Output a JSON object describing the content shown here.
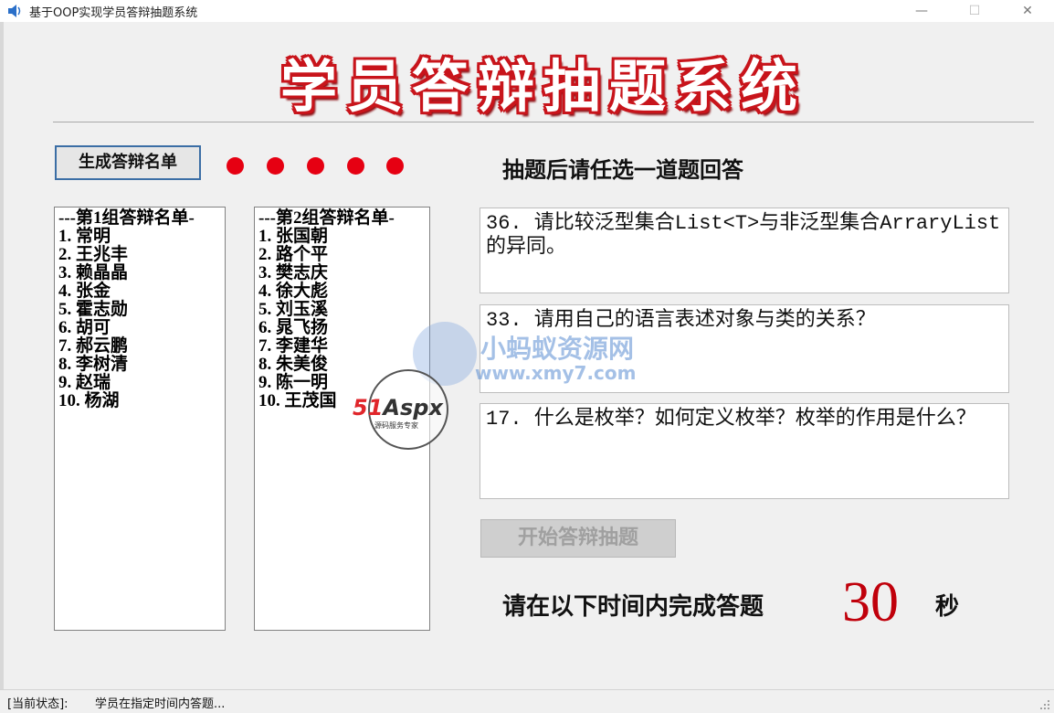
{
  "window": {
    "title": "基于OOP实现学员答辩抽题系统",
    "controls": [
      "—",
      "☐",
      "✕"
    ]
  },
  "banner": {
    "title": "学员答辩抽题系统"
  },
  "generate_button": {
    "label": "生成答辩名单"
  },
  "indicator_dots": {
    "count": 5,
    "color": "#e60012"
  },
  "hint": {
    "text": "抽题后请任选一道题回答"
  },
  "group1": {
    "items": [
      "---第1组答辩名单-",
      "1. 常明",
      "2. 王兆丰",
      "3. 赖晶晶",
      "4. 张金",
      "5. 霍志勋",
      "6. 胡可",
      "7. 郝云鹏",
      "8. 李树清",
      "9. 赵瑞",
      "10. 杨湖"
    ]
  },
  "group2": {
    "items": [
      "---第2组答辩名单-",
      "1. 张国朝",
      "2. 路个平",
      "3. 樊志庆",
      "4. 徐大彪",
      "5. 刘玉溪",
      "6. 晁飞扬",
      "7. 李建华",
      "8. 朱美俊",
      "9. 陈一明",
      "10. 王茂国"
    ]
  },
  "questions": [
    "36. 请比较泛型集合List<T>与非泛型集合ArraryList的异同。",
    "33. 请用自己的语言表述对象与类的关系？",
    "17. 什么是枚举？如何定义枚举？枚举的作用是什么？"
  ],
  "draw_button": {
    "label": "开始答辩抽题"
  },
  "timer": {
    "label": "请在以下时间内完成答题",
    "value": "30",
    "unit": "秒"
  },
  "status": {
    "label": "[当前状态]:",
    "text": "学员在指定时间内答题..."
  },
  "watermarks": {
    "site_name": "小蚂蚁资源网",
    "site_url": "www.xmy7.com",
    "logo_text_red": "51",
    "logo_text": "Aspx",
    "logo_sub": "源码服务专家"
  },
  "colors": {
    "accent_red": "#c8141b",
    "timer_red": "#c0000b",
    "button_border": "#3b6ea5"
  }
}
